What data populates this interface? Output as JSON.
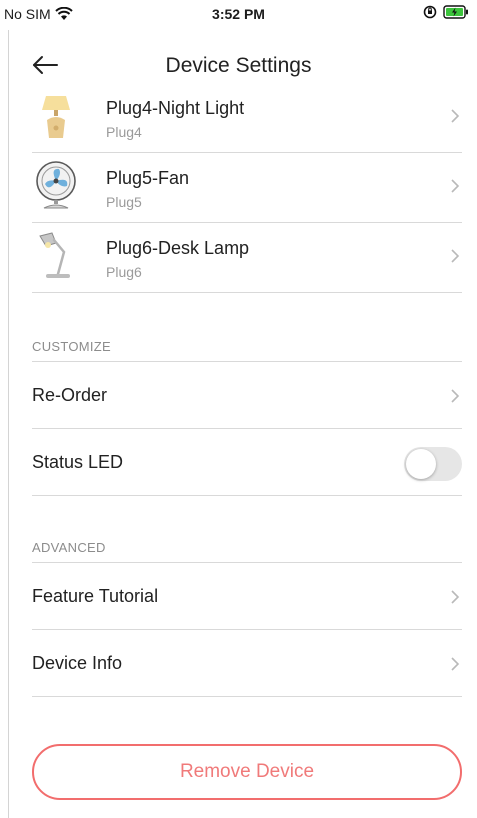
{
  "status_bar": {
    "carrier": "No SIM",
    "time": "3:52 PM"
  },
  "nav": {
    "title": "Device Settings"
  },
  "devices": [
    {
      "name": "Plug4-Night Light",
      "sub": "Plug4",
      "icon": "night-light-icon"
    },
    {
      "name": "Plug5-Fan",
      "sub": "Plug5",
      "icon": "fan-icon"
    },
    {
      "name": "Plug6-Desk Lamp",
      "sub": "Plug6",
      "icon": "desk-lamp-icon"
    }
  ],
  "customize": {
    "header": "CUSTOMIZE",
    "reorder_label": "Re-Order",
    "status_led_label": "Status LED",
    "status_led_on": false
  },
  "advanced": {
    "header": "ADVANCED",
    "tutorial_label": "Feature Tutorial",
    "device_info_label": "Device Info"
  },
  "remove_button": "Remove Device",
  "colors": {
    "accent_red": "#f26d6d",
    "toggle_off": "#e6e6e6"
  }
}
